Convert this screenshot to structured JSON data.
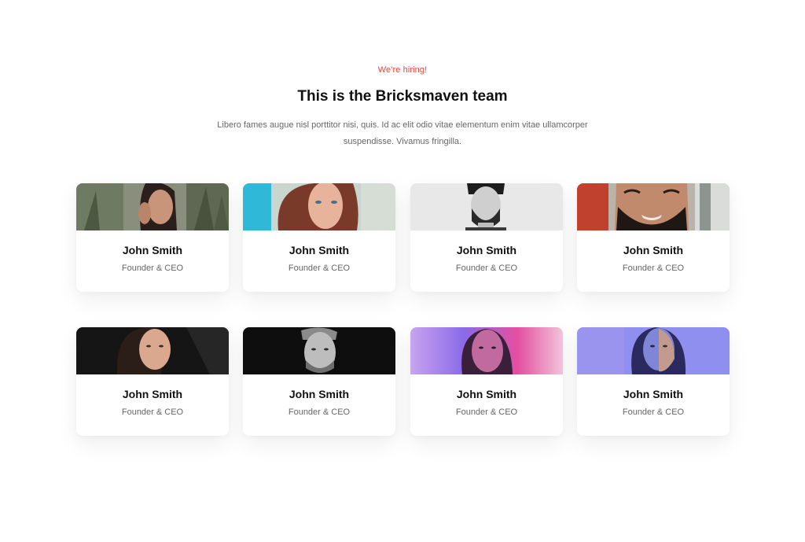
{
  "header": {
    "eyebrow": "We're hiring!",
    "title": "This is the Bricksmaven team",
    "description": "Libero fames augue nisl porttitor nisi, quis. Id ac elit odio vitae elementum enim vitae ullamcorper suspendisse. Vivamus fringilla."
  },
  "team": [
    {
      "name": "John Smith",
      "role": "Founder & CEO"
    },
    {
      "name": "John Smith",
      "role": "Founder & CEO"
    },
    {
      "name": "John Smith",
      "role": "Founder & CEO"
    },
    {
      "name": "John Smith",
      "role": "Founder & CEO"
    },
    {
      "name": "John Smith",
      "role": "Founder & CEO"
    },
    {
      "name": "John Smith",
      "role": "Founder & CEO"
    },
    {
      "name": "John Smith",
      "role": "Founder & CEO"
    },
    {
      "name": "John Smith",
      "role": "Founder & CEO"
    }
  ],
  "colors": {
    "accent": "#e8473a",
    "heading": "#111111",
    "body_text": "#666666"
  }
}
